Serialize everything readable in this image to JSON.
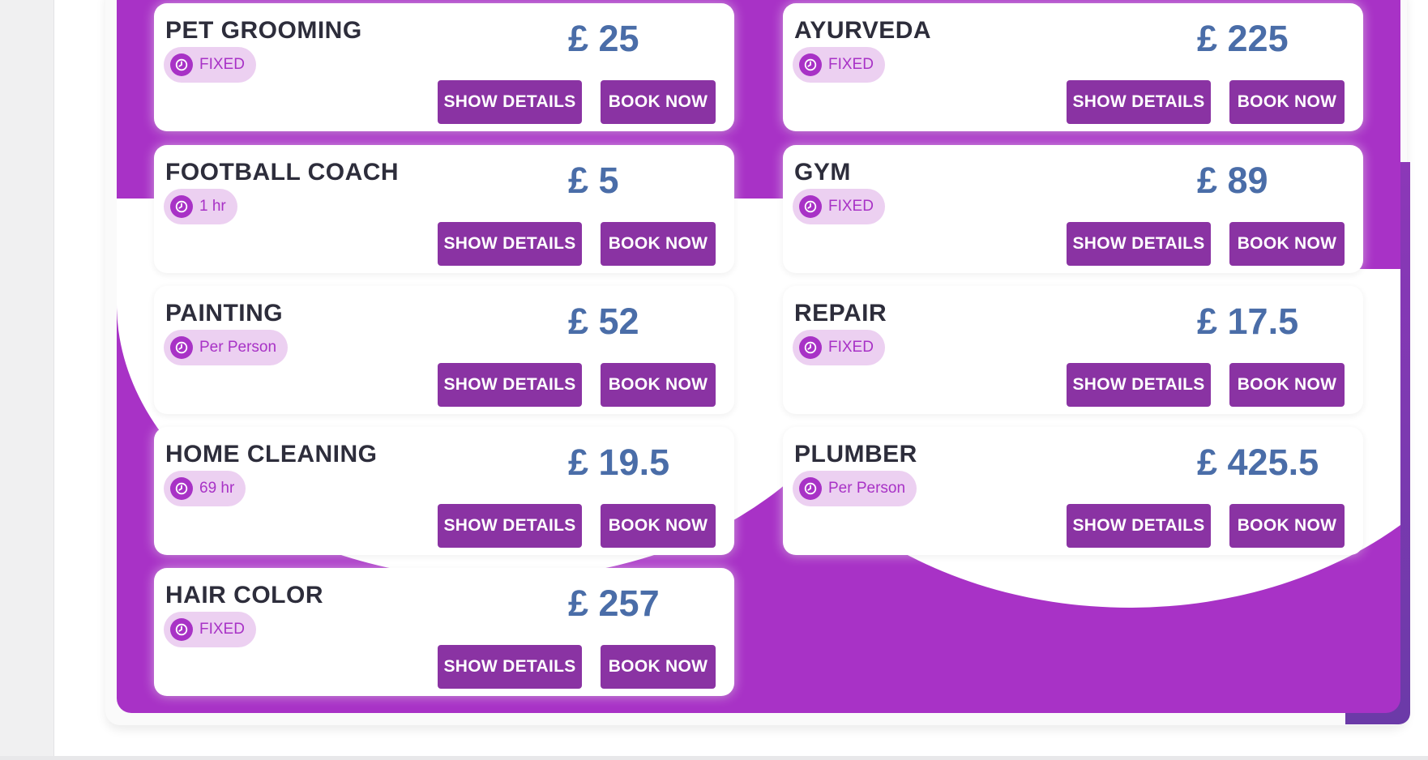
{
  "services": [
    {
      "name": "PET GROOMING",
      "badge": "FIXED",
      "price": "£ 25",
      "show_label": "SHOW DETAILS",
      "book_label": "BOOK NOW"
    },
    {
      "name": "AYURVEDA",
      "badge": "FIXED",
      "price": "£ 225",
      "show_label": "SHOW DETAILS",
      "book_label": "BOOK NOW"
    },
    {
      "name": "FOOTBALL COACH",
      "badge": "1 hr",
      "price": "£ 5",
      "show_label": "SHOW DETAILS",
      "book_label": "BOOK NOW"
    },
    {
      "name": "GYM",
      "badge": "FIXED",
      "price": "£ 89",
      "show_label": "SHOW DETAILS",
      "book_label": "BOOK NOW"
    },
    {
      "name": "PAINTING",
      "badge": "Per Person",
      "price": "£ 52",
      "show_label": "SHOW DETAILS",
      "book_label": "BOOK NOW"
    },
    {
      "name": "REPAIR",
      "badge": "FIXED",
      "price": "£ 17.5",
      "show_label": "SHOW DETAILS",
      "book_label": "BOOK NOW"
    },
    {
      "name": "HOME CLEANING",
      "badge": "69 hr",
      "price": "£ 19.5",
      "show_label": "SHOW DETAILS",
      "book_label": "BOOK NOW"
    },
    {
      "name": "PLUMBER",
      "badge": "Per Person",
      "price": "£ 425.5",
      "show_label": "SHOW DETAILS",
      "book_label": "BOOK NOW"
    },
    {
      "name": "HAIR COLOR",
      "badge": "FIXED",
      "price": "£ 257",
      "show_label": "SHOW DETAILS",
      "book_label": "BOOK NOW"
    }
  ],
  "icons": {
    "badge_icon": "clock-icon"
  },
  "colors": {
    "panel_purple": "#a832c6",
    "button_purple": "#8a33a3",
    "price_blue": "#4a6da8",
    "badge_background": "#ecd0f1"
  }
}
